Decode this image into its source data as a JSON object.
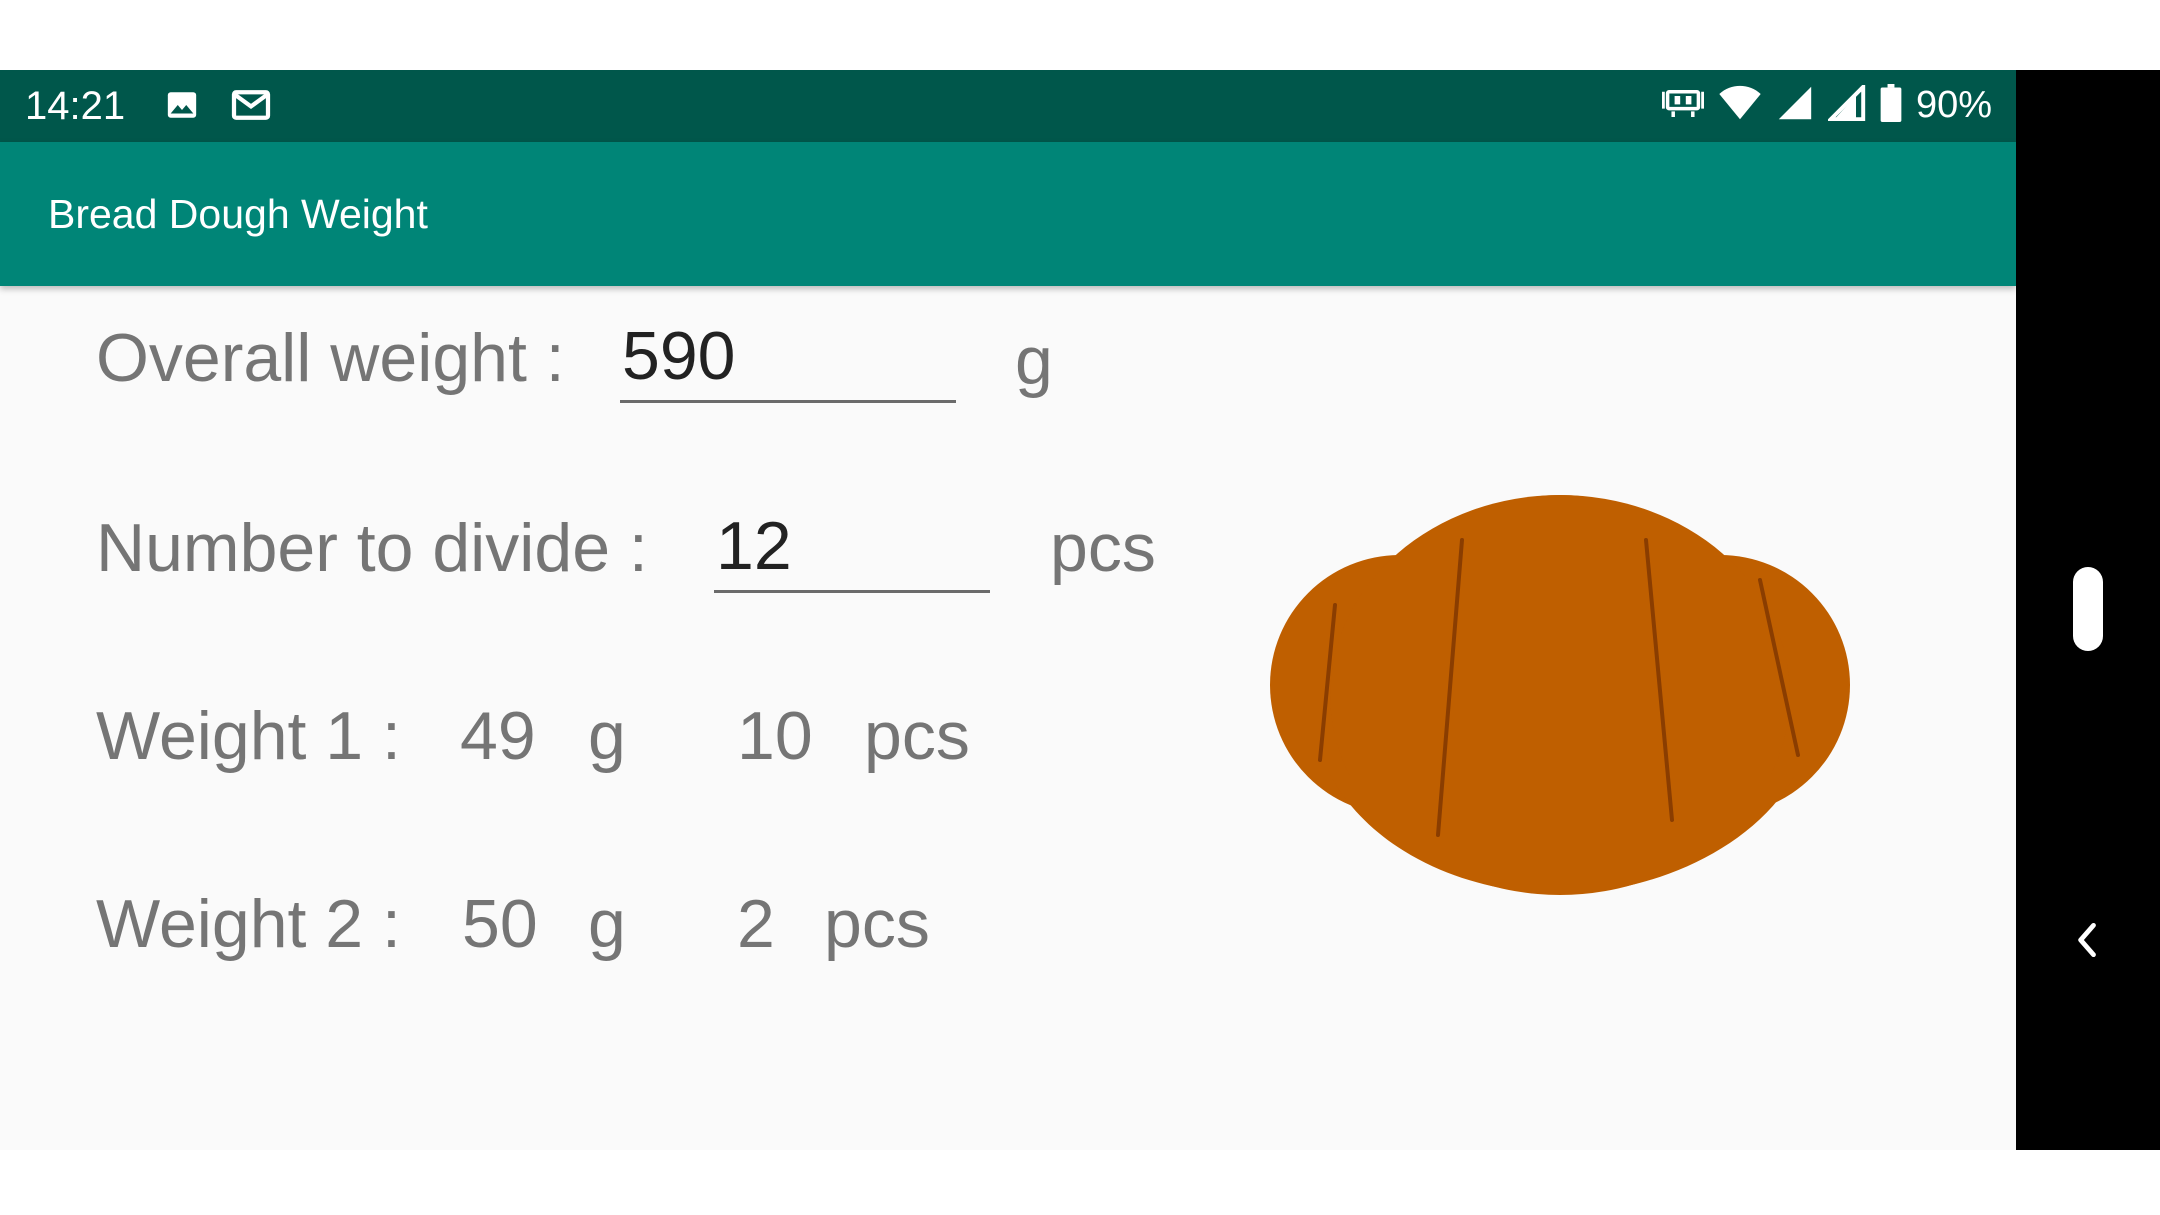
{
  "status_bar": {
    "time": "14:21",
    "left_icons": [
      "image-icon",
      "gmail-icon"
    ],
    "right_icons": [
      "vibrate-icon",
      "wifi-icon",
      "signal-icon",
      "signal-icon",
      "battery-icon"
    ],
    "battery": "90%"
  },
  "app_bar": {
    "title": "Bread Dough Weight"
  },
  "form": {
    "overall_weight": {
      "label": "Overall weight :",
      "value": "590",
      "unit": "g"
    },
    "number_to_divide": {
      "label": "Number to divide :",
      "value": "12",
      "unit": "pcs"
    }
  },
  "results": {
    "weight1": {
      "label": "Weight 1 :",
      "grams": "49",
      "gram_unit": "g",
      "count": "10",
      "count_unit": "pcs"
    },
    "weight2": {
      "label": "Weight 2 :",
      "grams": "50",
      "gram_unit": "g",
      "count": "2",
      "count_unit": "pcs"
    }
  },
  "illustration": {
    "name": "bread-roll",
    "color": "#bf5f00",
    "line_color": "#8a3d00"
  },
  "colors": {
    "status_bar": "#00574b",
    "app_bar": "#008577",
    "background": "#fafafa"
  }
}
